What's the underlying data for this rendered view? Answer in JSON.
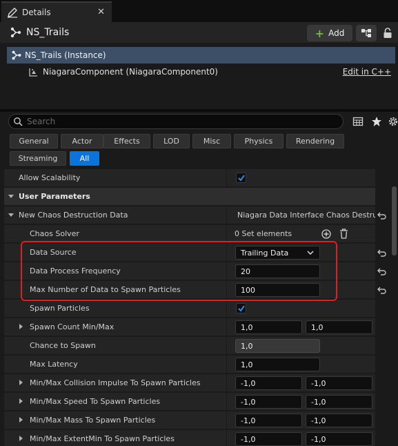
{
  "tab": {
    "label": "Details",
    "close": "✕"
  },
  "header": {
    "title": "NS_Trails",
    "add_label": "Add"
  },
  "tree": {
    "selected": "NS_Trails (Instance)",
    "component": "NiagaraComponent (NiagaraComponent0)",
    "edit_link": "Edit in C++"
  },
  "search": {
    "placeholder": "Search"
  },
  "filters": [
    "General",
    "Actor",
    "Effects",
    "LOD",
    "Misc",
    "Physics",
    "Rendering",
    "Streaming",
    "All"
  ],
  "active_filter": "All",
  "properties": {
    "allow_scalability": {
      "label": "Allow Scalability",
      "checked": true
    },
    "user_parameters": {
      "label": "User Parameters"
    },
    "chaos_data": {
      "label": "New Chaos Destruction Data",
      "value": "Niagara Data Interface Chaos Destruct"
    },
    "chaos_solver": {
      "label": "Chaos Solver",
      "value": "0 Set elements"
    },
    "data_source": {
      "label": "Data Source",
      "value": "Trailing Data"
    },
    "data_process_frequency": {
      "label": "Data Process Frequency",
      "value": "20"
    },
    "max_number_data": {
      "label": "Max Number of Data to Spawn Particles",
      "value": "100"
    },
    "spawn_particles": {
      "label": "Spawn Particles",
      "checked": true
    },
    "spawn_count": {
      "label": "Spawn Count Min/Max",
      "min": "1,0",
      "max": "1,0"
    },
    "chance_to_spawn": {
      "label": "Chance to Spawn",
      "value": "1,0"
    },
    "max_latency": {
      "label": "Max Latency",
      "value": "1,0"
    },
    "collision_impulse": {
      "label": "Min/Max Collision Impulse To Spawn Particles",
      "min": "-1,0",
      "max": "-1,0"
    },
    "speed": {
      "label": "Min/Max Speed To Spawn Particles",
      "min": "-1,0",
      "max": "-1,0"
    },
    "mass": {
      "label": "Min/Max Mass To Spawn Particles",
      "min": "-1,0",
      "max": "-1,0"
    },
    "extent_min": {
      "label": "Min/Max ExtentMin To Spawn Particles",
      "min": "-1,0",
      "max": "-1,0"
    }
  },
  "colors": {
    "accent": "#0a74da",
    "highlight": "#e02020",
    "selection": "#3d4f66"
  }
}
